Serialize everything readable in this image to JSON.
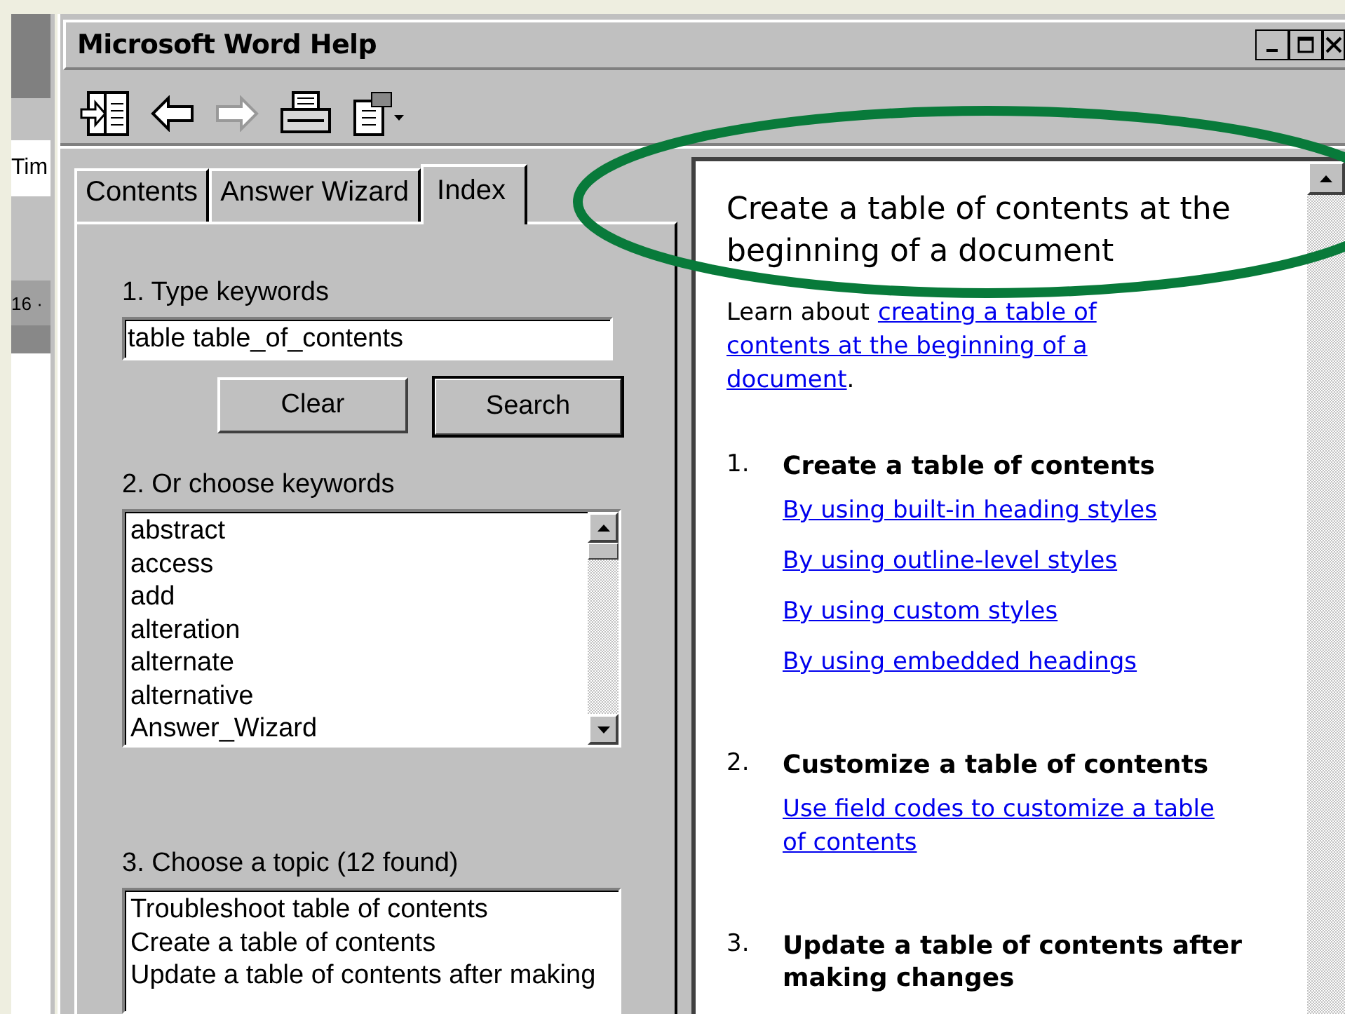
{
  "background_document": {
    "texts": [
      "Tim",
      "16 ·"
    ]
  },
  "window": {
    "title": "Microsoft Word Help"
  },
  "toolbar": {
    "buttons": [
      {
        "kind": "show",
        "disabled": false
      },
      {
        "kind": "back",
        "disabled": false
      },
      {
        "kind": "forward",
        "disabled": true
      },
      {
        "kind": "print",
        "disabled": false
      },
      {
        "kind": "options",
        "disabled": false
      }
    ]
  },
  "tabs": [
    {
      "label": "Contents",
      "selected": false
    },
    {
      "label": "Answer Wizard",
      "selected": false
    },
    {
      "label": "Index",
      "selected": true
    }
  ],
  "index": {
    "step1": "1. Type keywords",
    "keywords_value": "table table_of_contents",
    "buttons": [
      {
        "label": "Clear",
        "default": false
      },
      {
        "label": "Search",
        "default": true
      }
    ],
    "step2": "2. Or choose keywords",
    "keywords": [
      "abstract",
      "access",
      "add",
      "alteration",
      "alternate",
      "alternative",
      "Answer_Wizard"
    ],
    "step3": "3. Choose a topic (12 found)",
    "topics": [
      "Troubleshoot table of contents",
      "Create a table of contents",
      "Update a table of contents after making"
    ]
  },
  "article": {
    "title": "Create a table of contents at the beginning of a document",
    "intro": "Learn about",
    "intro_link_lines": [
      "creating a table of",
      "contents at the beginning of a",
      "document"
    ],
    "intro_end": ".",
    "sections": [
      {
        "number": "1.",
        "heading": "Create a table of contents",
        "links": [
          "By using built-in heading styles",
          "By using outline-level styles",
          "By using custom styles",
          "By using embedded headings"
        ]
      },
      {
        "number": "2.",
        "heading": "Customize a table of contents",
        "links": [
          "Use field codes to customize a table of contents"
        ]
      },
      {
        "number": "3.",
        "heading": "Update a table of contents after making changes"
      }
    ]
  }
}
